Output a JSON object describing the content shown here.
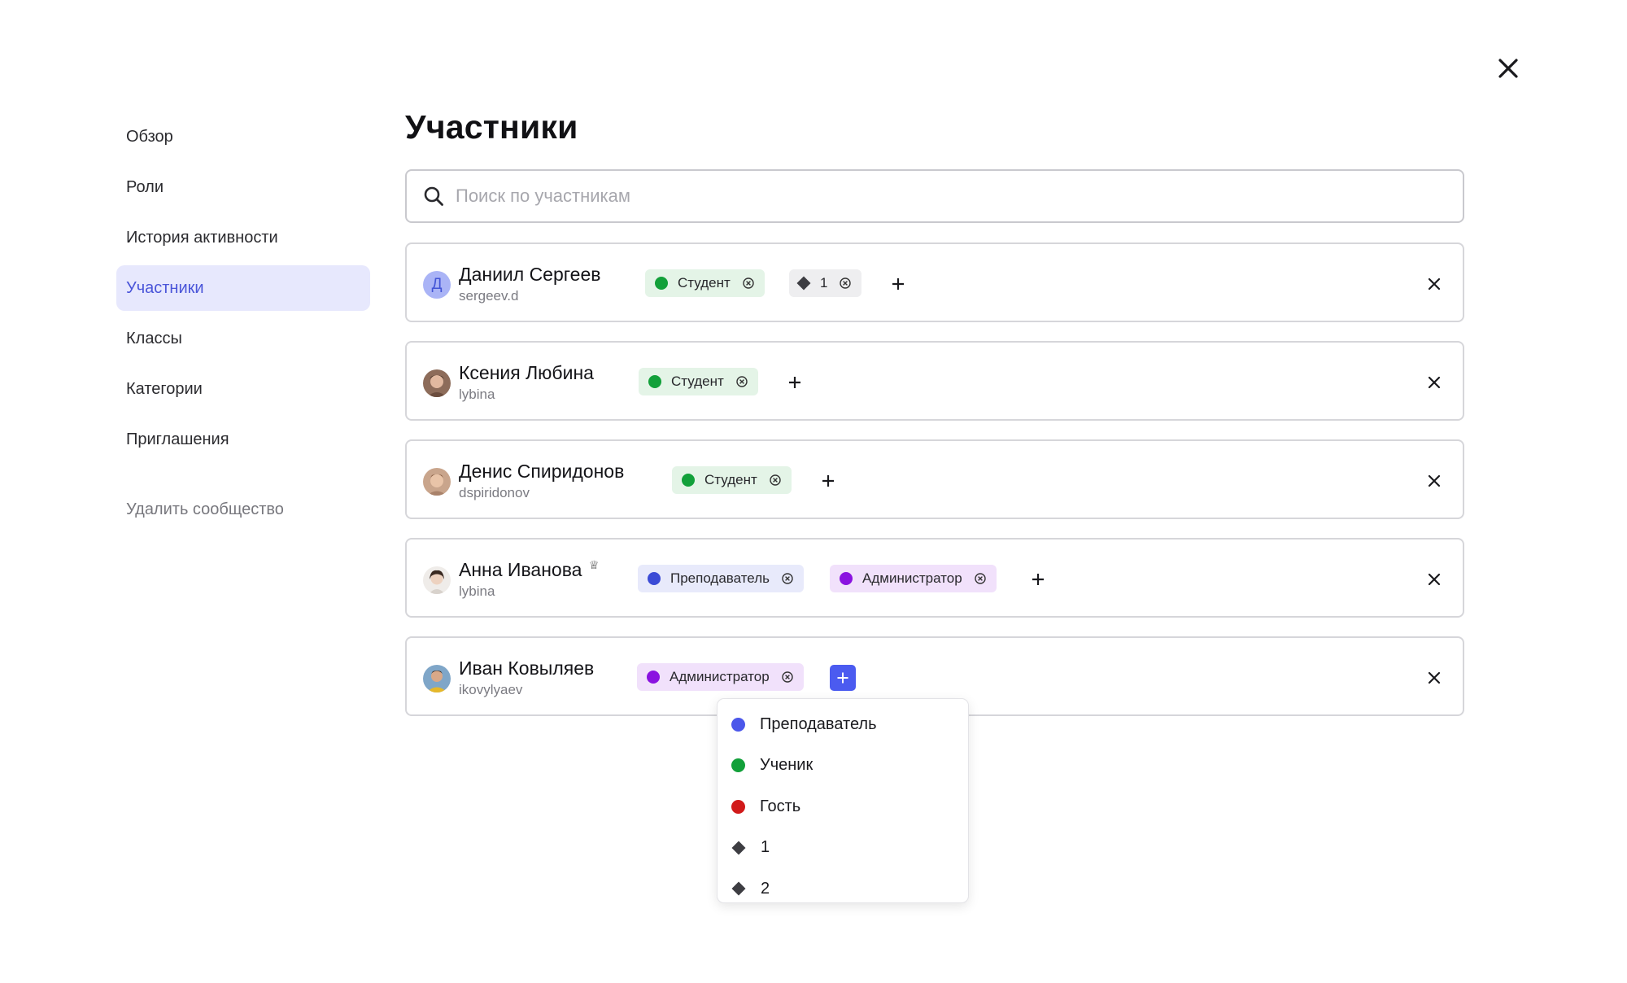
{
  "sidebar": {
    "items": [
      {
        "label": "Обзор",
        "active": false
      },
      {
        "label": "Роли",
        "active": false
      },
      {
        "label": "История активности",
        "active": false
      },
      {
        "label": "Участники",
        "active": true
      },
      {
        "label": "Классы",
        "active": false
      },
      {
        "label": "Категории",
        "active": false
      },
      {
        "label": "Приглашения",
        "active": false
      }
    ],
    "danger_label": "Удалить сообщество"
  },
  "main": {
    "title": "Участники",
    "search": {
      "placeholder": "Поиск по участникам",
      "value": ""
    }
  },
  "members": [
    {
      "name": "Даниил Сергеев",
      "login": "sergeev.d",
      "avatar": {
        "type": "letter",
        "letter": "Д"
      },
      "tags": [
        {
          "kind": "role",
          "label": "Студент",
          "color": "#12a03a",
          "bg": "#e4f4e7"
        },
        {
          "kind": "category",
          "label": "1",
          "bg": "#eeeef0"
        }
      ]
    },
    {
      "name": "Ксения Любина",
      "login": "lybina",
      "avatar": {
        "type": "photo"
      },
      "tags": [
        {
          "kind": "role",
          "label": "Студент",
          "color": "#12a03a",
          "bg": "#e4f4e7"
        }
      ]
    },
    {
      "name": "Денис Спиридонов",
      "login": "dspiridonov",
      "avatar": {
        "type": "photo"
      },
      "tags": [
        {
          "kind": "role",
          "label": "Студент",
          "color": "#12a03a",
          "bg": "#e4f4e7"
        }
      ]
    },
    {
      "name": "Анна Иванова",
      "login": "lybina",
      "owner": true,
      "avatar": {
        "type": "photo"
      },
      "tags": [
        {
          "kind": "role",
          "label": "Преподаватель",
          "color": "#3b4bd6",
          "bg": "#e8eafb"
        },
        {
          "kind": "role",
          "label": "Администратор",
          "color": "#8a12e0",
          "bg": "#f1e1fb"
        }
      ]
    },
    {
      "name": "Иван Ковыляев",
      "login": "ikovylyaev",
      "avatar": {
        "type": "photo"
      },
      "tags": [
        {
          "kind": "role",
          "label": "Администратор",
          "color": "#8a12e0",
          "bg": "#f1e1fb"
        }
      ]
    }
  ],
  "dropdown": {
    "items": [
      {
        "kind": "role",
        "label": "Преподаватель",
        "color": "#4b57ea"
      },
      {
        "kind": "role",
        "label": "Ученик",
        "color": "#12a03a"
      },
      {
        "kind": "role",
        "label": "Гость",
        "color": "#d11a1a"
      },
      {
        "kind": "category",
        "label": "1"
      },
      {
        "kind": "category",
        "label": "2"
      }
    ]
  },
  "colors": {
    "accent": "#4b5bf0",
    "active_nav_bg": "#e7e8fd",
    "active_nav_text": "#4a55d9"
  },
  "icons": {
    "close": "close-icon",
    "search": "search-icon",
    "add": "plus-icon",
    "tag_remove": "circle-x-icon",
    "owner": "crown-icon"
  }
}
